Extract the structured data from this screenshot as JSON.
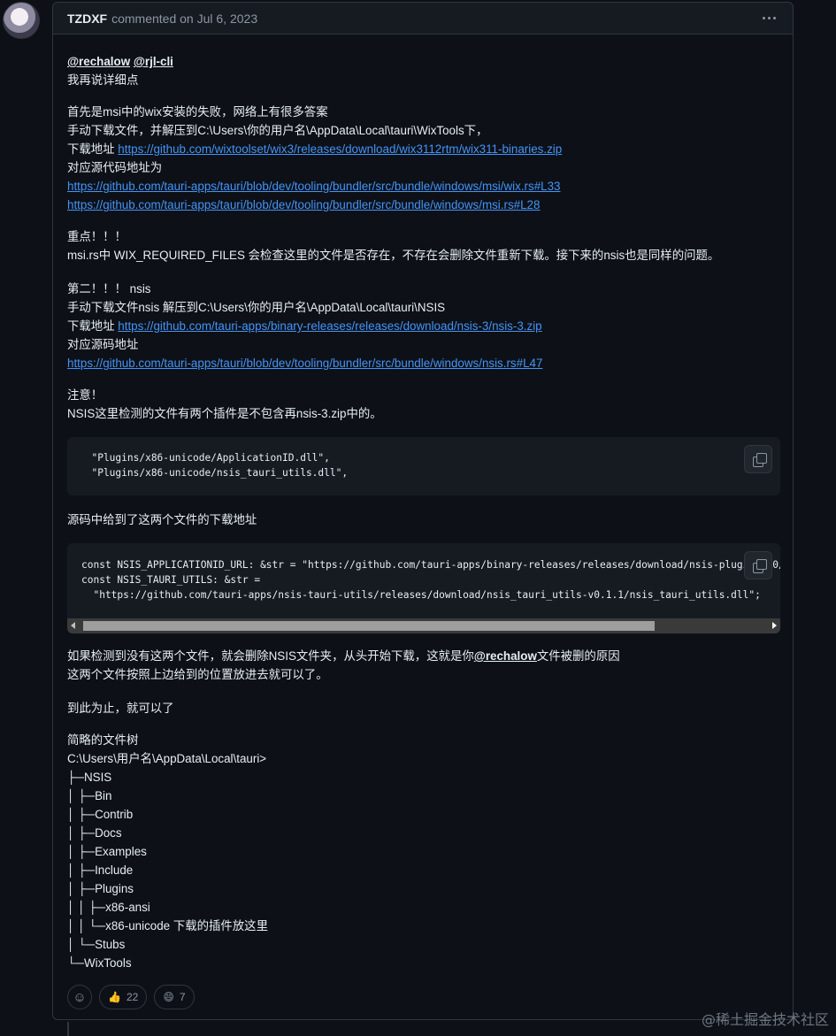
{
  "comment": {
    "author": "TZDXF",
    "meta": "commented on Jul 6, 2023",
    "menu_icon": "kebab-horizontal-icon"
  },
  "body": {
    "mention1": "@rechalow",
    "mention2": "@rjl-cli",
    "l_detail": "我再说详细点",
    "l_wix_fail": "首先是msi中的wix安装的失败，网络上有很多答案",
    "l_wix_manual": "手动下载文件，并解压到C:\\Users\\你的用户名\\AppData\\Local\\tauri\\WixTools下，",
    "dl_label": "下载地址 ",
    "wix_link": "https://github.com/wixtoolset/wix3/releases/download/wix3112rtm/wix311-binaries.zip",
    "src_label": "对应源代码地址为",
    "wix_src1": "https://github.com/tauri-apps/tauri/blob/dev/tooling/bundler/src/bundle/windows/msi/wix.rs#L33",
    "wix_src2": "https://github.com/tauri-apps/tauri/blob/dev/tooling/bundler/src/bundle/windows/msi.rs#L28",
    "important": "重点！！！",
    "msi_check": "msi.rs中 WIX_REQUIRED_FILES 会检查这里的文件是否存在，不存在会删除文件重新下载。接下来的nsis也是同样的问题。",
    "second": "第二！！！ nsis",
    "nsis_manual": "手动下载文件nsis 解压到C:\\Users\\你的用户名\\AppData\\Local\\tauri\\NSIS",
    "nsis_link": "https://github.com/tauri-apps/binary-releases/releases/download/nsis-3/nsis-3.zip",
    "nsis_src_label": "对应源码地址",
    "nsis_src": "https://github.com/tauri-apps/tauri/blob/dev/tooling/bundler/src/bundle/windows/nsis.rs#L47",
    "note": "注意！",
    "nsis_plugins": "NSIS这里检测的文件有两个插件是不包含再nsis-3.zip中的。",
    "code1": [
      "  \"Plugins/x86-unicode/ApplicationID.dll\",",
      "  \"Plugins/x86-unicode/nsis_tauri_utils.dll\","
    ],
    "src_gives": "源码中给到了这两个文件的下载地址",
    "code2": [
      "const NSIS_APPLICATIONID_URL: &str = \"https://github.com/tauri-apps/binary-releases/releases/download/nsis-plugins-v0/NSIS-ApplicationID.zip\";",
      "const NSIS_TAURI_UTILS: &str =",
      "  \"https://github.com/tauri-apps/nsis-tauri-utils/releases/download/nsis_tauri_utils-v0.1.1/nsis_tauri_utils.dll\";"
    ],
    "if_missing_a": "如果检测到没有这两个文件，就会删除NSIS文件夹，从头开始下载，这就是你",
    "if_missing_mention": "@rechalow",
    "if_missing_b": "文件被删的原因",
    "put_files": "这两个文件按照上边给到的位置放进去就可以了。",
    "done": "到此为止，就可以了",
    "tree_title": "简略的文件树",
    "tree": [
      "C:\\Users\\用户名\\AppData\\Local\\tauri>",
      "├─NSIS",
      "│  ├─Bin",
      "│  ├─Contrib",
      "│  ├─Docs",
      "│  ├─Examples",
      "│  ├─Include",
      "│  ├─Plugins",
      "│  │  ├─x86-ansi",
      "│  │  └─x86-unicode 下载的插件放这里",
      "│  └─Stubs",
      "└─WixTools"
    ]
  },
  "reactions": {
    "add_icon": "smiley-icon",
    "thumbs_emoji": "👍",
    "thumbs_count": "22",
    "laugh_emoji": "😄",
    "laugh_count": "7"
  },
  "watermark": "@稀土掘金技术社区"
}
